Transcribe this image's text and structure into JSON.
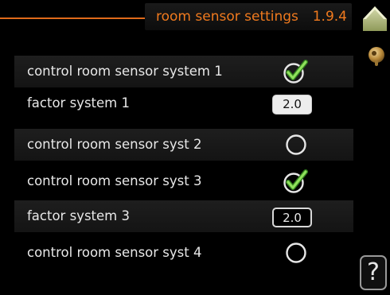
{
  "header": {
    "title": "room sensor settings",
    "menu_code": "1.9.4",
    "accent_color": "#f07a1e"
  },
  "side_icons": {
    "home": "house-icon",
    "temperature": "thermometer-knob-icon",
    "help": "help-icon",
    "help_glyph": "?"
  },
  "rows": [
    {
      "label": "control room sensor system 1",
      "control": "checkbox",
      "checked": true
    },
    {
      "label": "factor system 1",
      "control": "value",
      "value": "2.0",
      "selected": true
    },
    {
      "label": "control room sensor syst 2",
      "control": "checkbox",
      "checked": false
    },
    {
      "label": "control room sensor syst 3",
      "control": "checkbox",
      "checked": true
    },
    {
      "label": "factor system 3",
      "control": "value",
      "value": "2.0",
      "selected": false
    },
    {
      "label": "control room sensor syst 4",
      "control": "checkbox",
      "checked": false
    }
  ]
}
